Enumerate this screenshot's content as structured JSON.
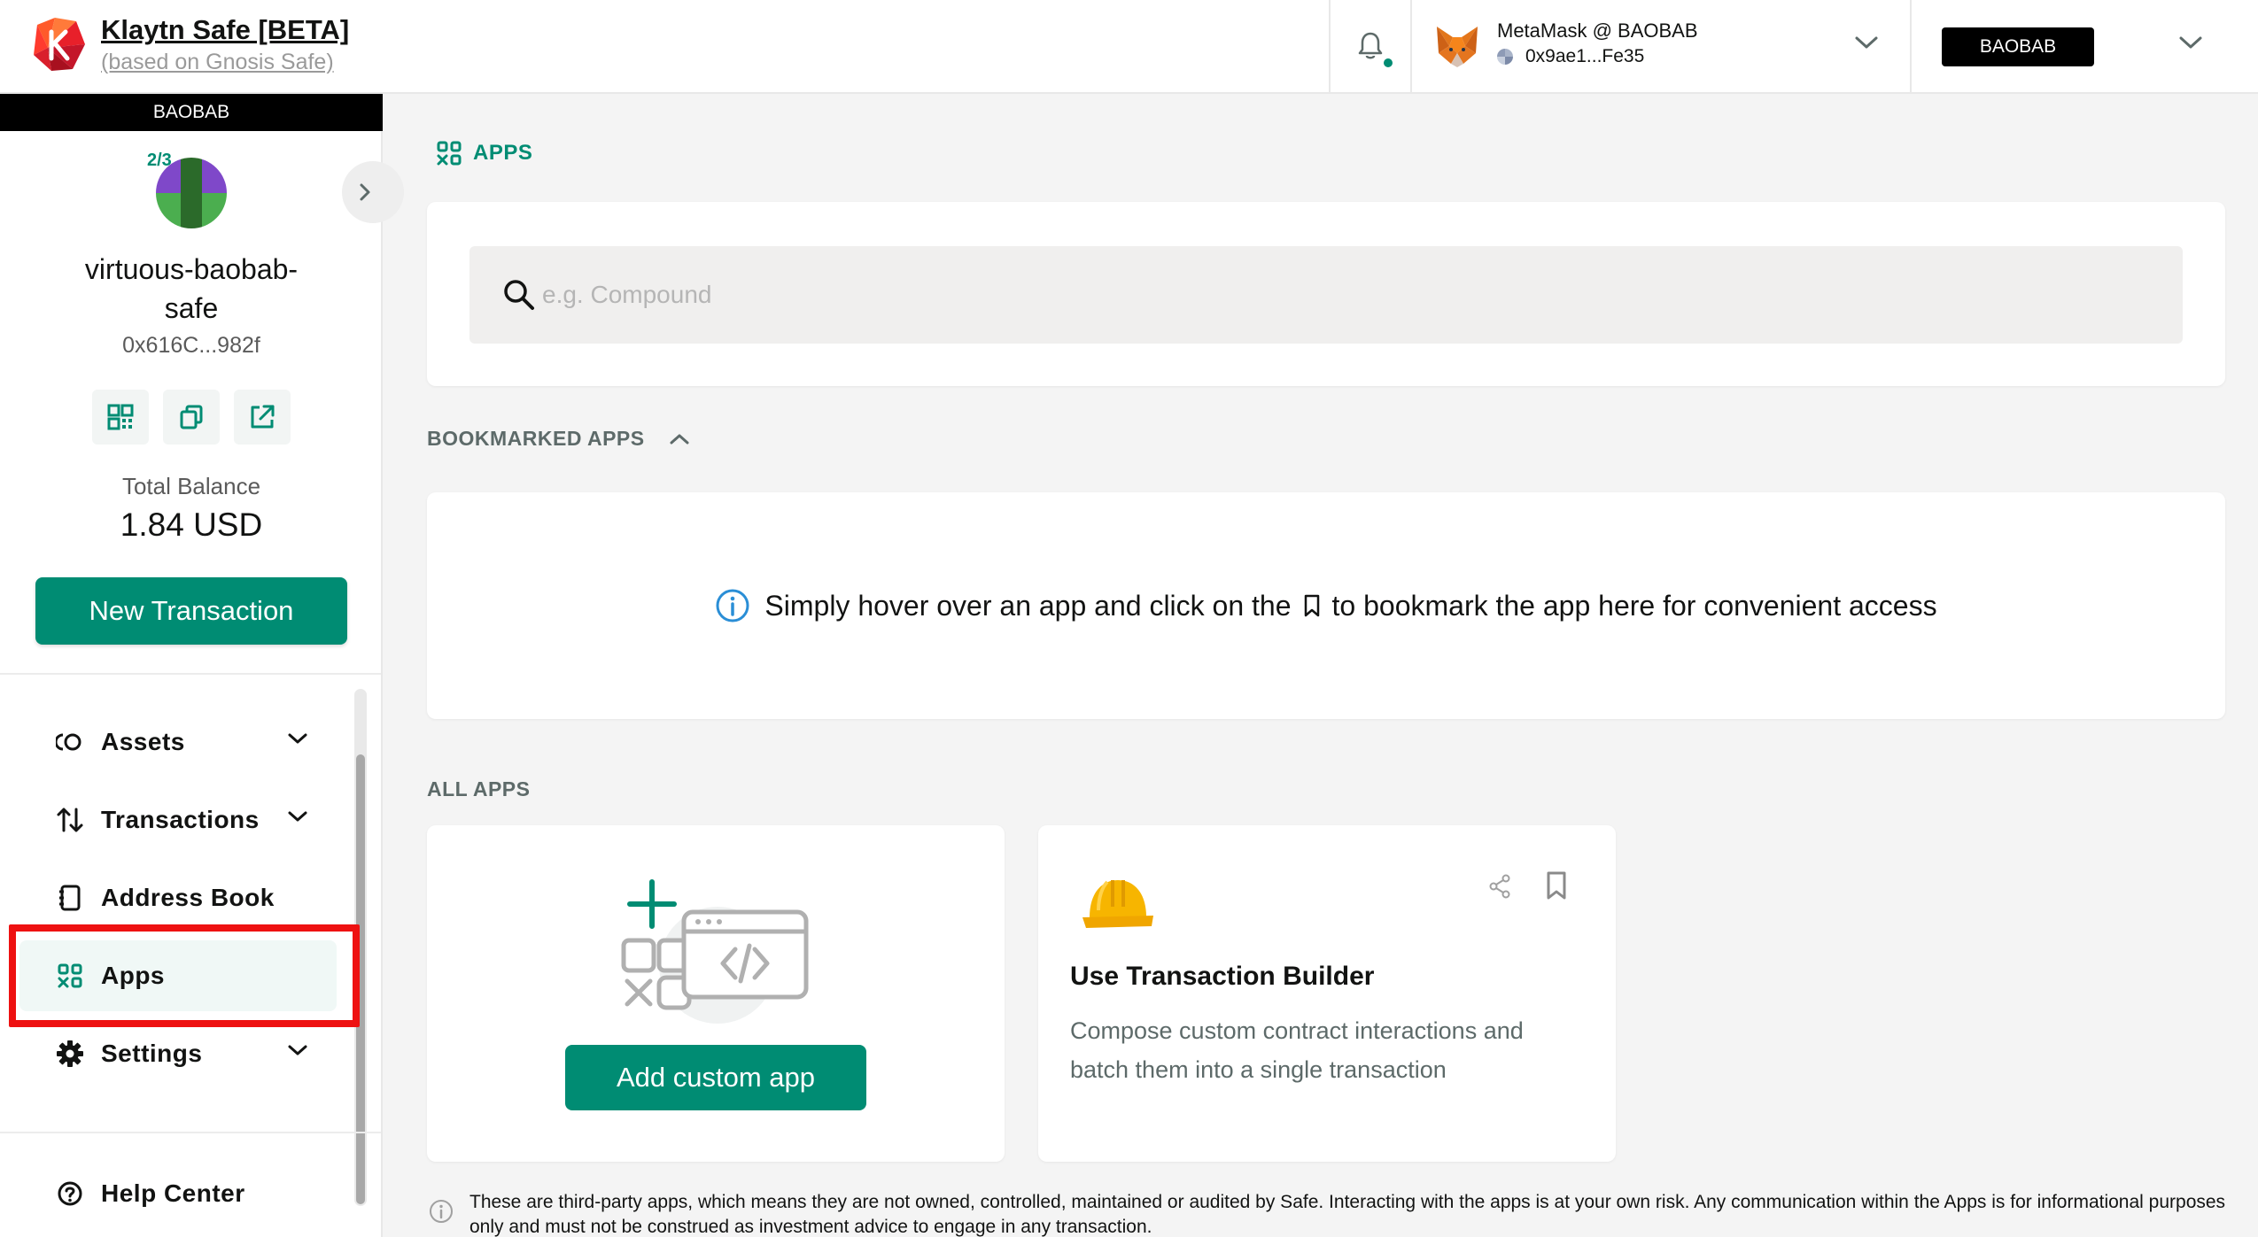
{
  "header": {
    "title": "Klaytn Safe [BETA]",
    "subtitle": "(based on Gnosis Safe)",
    "wallet_name": "MetaMask @ BAOBAB",
    "wallet_address": "0x9ae1...Fe35",
    "network": "BAOBAB",
    "icons": {
      "logo": "klaytn-logo",
      "bell": "bell-icon",
      "wallet": "metamask-fox-icon",
      "chevron": "chevron-down-icon"
    },
    "colors": {
      "accent": "#008c73",
      "network_badge": "#000000"
    }
  },
  "sidebar": {
    "network": "BAOBAB",
    "threshold": "2/3",
    "safe_name": "virtuous-baobab-safe",
    "safe_address": "0x616C...982f",
    "actions": [
      {
        "icon": "qr-code-icon"
      },
      {
        "icon": "copy-icon"
      },
      {
        "icon": "external-link-icon"
      }
    ],
    "balance_label": "Total Balance",
    "balance_value": "1.84 USD",
    "new_transaction": "New Transaction",
    "nav": [
      {
        "label": "Assets",
        "icon": "assets-icon",
        "expandable": true
      },
      {
        "label": "Transactions",
        "icon": "transactions-icon",
        "expandable": true
      },
      {
        "label": "Address Book",
        "icon": "address-book-icon",
        "expandable": false
      },
      {
        "label": "Apps",
        "icon": "apps-icon",
        "expandable": false,
        "active": true
      },
      {
        "label": "Settings",
        "icon": "settings-icon",
        "expandable": true
      }
    ],
    "help": {
      "label": "Help Center",
      "icon": "help-icon"
    },
    "highlight_color": "#ee1111"
  },
  "main": {
    "title": "APPS",
    "search": {
      "placeholder": "e.g. Compound",
      "value": ""
    },
    "bookmarked_label": "BOOKMARKED APPS",
    "bookmark_hint_before": "Simply hover over an app and click on the",
    "bookmark_hint_after": "to bookmark the app here for convenient access",
    "all_apps_label": "ALL APPS",
    "add_custom_app": "Add custom app",
    "apps": [
      {
        "title": "Use Transaction Builder",
        "description": "Compose custom contract interactions and batch them into a single transaction",
        "icon": "hard-hat-icon"
      }
    ],
    "disclaimer": "These are third-party apps, which means they are not owned, controlled, maintained or audited by Safe. Interacting with the apps is at your own risk. Any communication within the Apps is for informational purposes only and must not be construed as investment advice to engage in any transaction."
  }
}
